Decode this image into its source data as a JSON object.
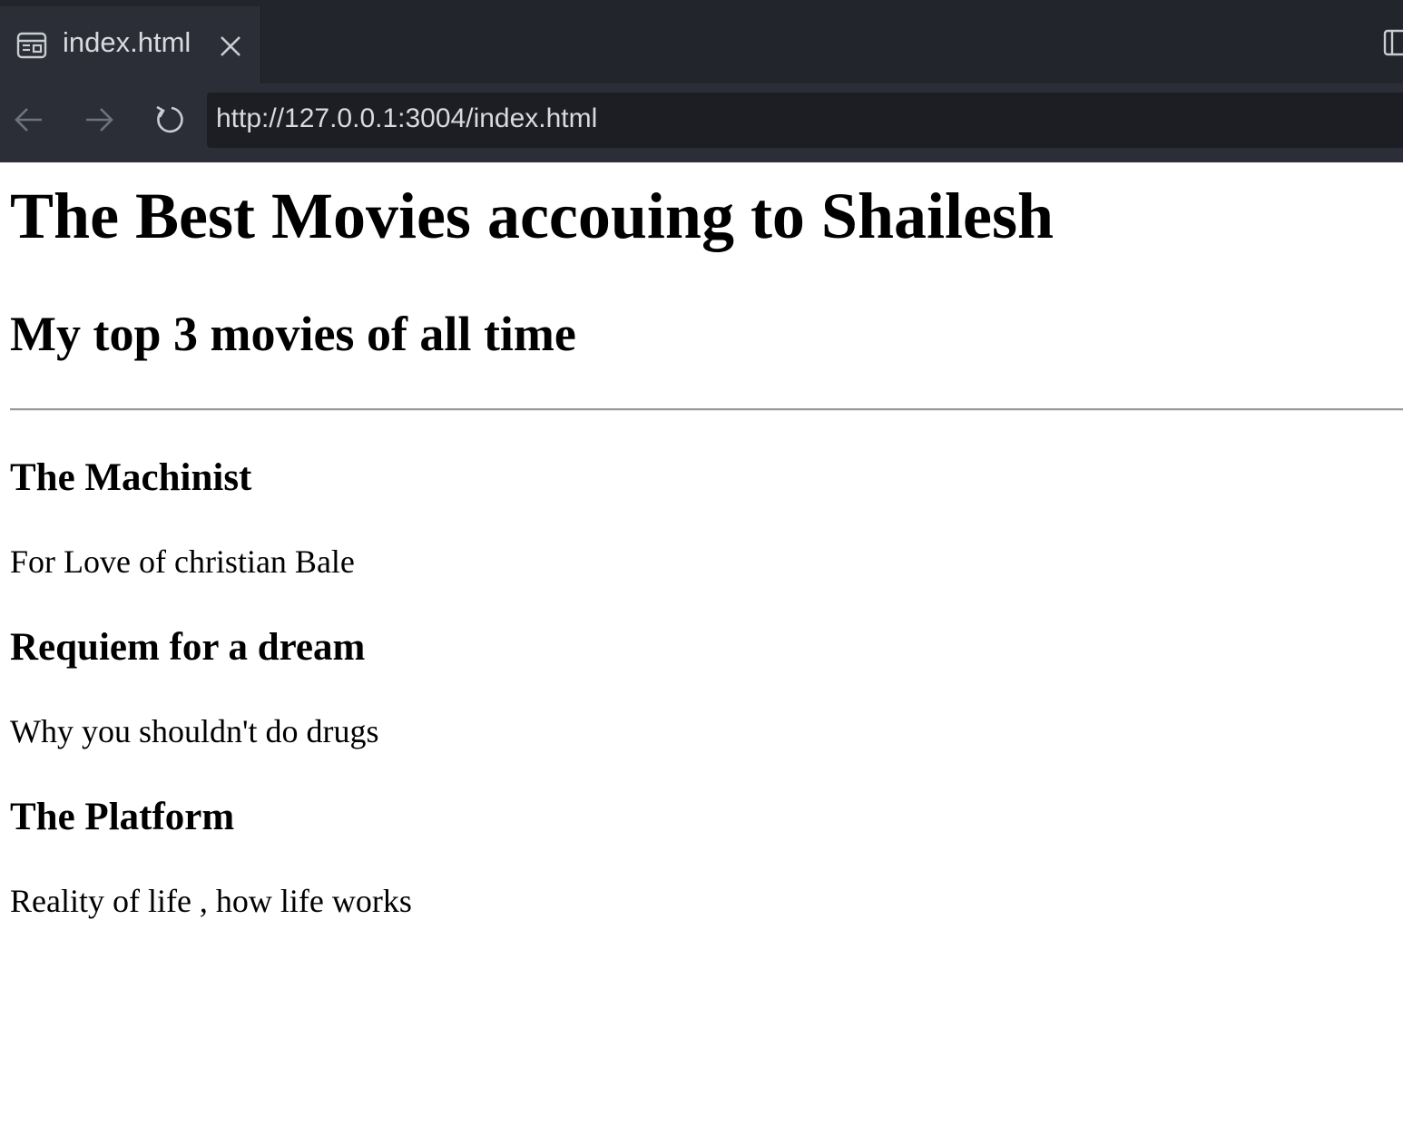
{
  "browser": {
    "tab": {
      "title": "index.html",
      "icon": "page-layout-icon",
      "close_icon": "close-icon"
    },
    "nav": {
      "back_icon": "arrow-left-icon",
      "forward_icon": "arrow-right-icon",
      "reload_icon": "reload-icon",
      "url": "http://127.0.0.1:3004/index.html"
    },
    "split_icon": "split-view-icon"
  },
  "page": {
    "heading": "The Best Movies accouing to Shailesh",
    "subheading": "My top 3 movies of all time",
    "movies": [
      {
        "title": "The Machinist",
        "description": "For Love of christian Bale"
      },
      {
        "title": "Requiem for a dream",
        "description": "Why you shouldn't do drugs"
      },
      {
        "title": "The Platform",
        "description": "Reality of life , how life works"
      }
    ]
  },
  "colors": {
    "chrome_bg": "#2b2e36",
    "tabbar_bg": "#22252c",
    "url_bg": "#1c1e23",
    "chrome_text": "#d8dae0",
    "page_bg": "#ffffff"
  }
}
